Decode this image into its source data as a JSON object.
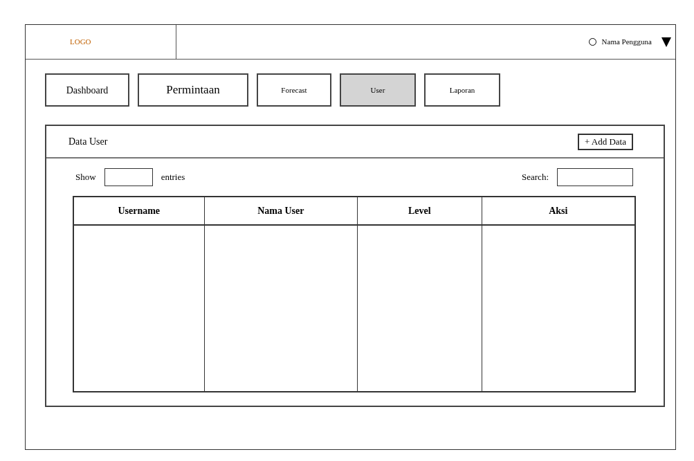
{
  "header": {
    "logo": "LOGO",
    "user_name": "Nama Pengguna"
  },
  "nav": [
    {
      "label": "Dashboard",
      "selected": false
    },
    {
      "label": "Permintaan",
      "selected": false
    },
    {
      "label": "Forecast",
      "selected": false
    },
    {
      "label": "User",
      "selected": true
    },
    {
      "label": "Laporan",
      "selected": false
    }
  ],
  "panel": {
    "title": "Data User",
    "add_button": "+ Add Data",
    "show_label": "Show",
    "entries_label": "entries",
    "search_label": "Search:"
  },
  "table": {
    "columns": [
      "Username",
      "Nama User",
      "Level",
      "Aksi"
    ]
  }
}
